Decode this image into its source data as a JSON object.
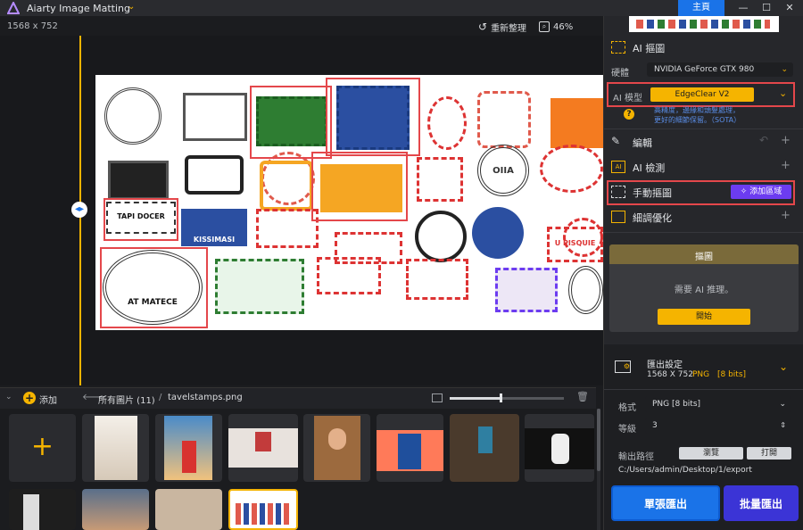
{
  "titlebar": {
    "app_title": "Aiarty Image Matting",
    "home_button": "主頁",
    "minimize": "—",
    "maximize": "☐",
    "close": "✕"
  },
  "toolbar": {
    "image_dims": "1568 x 752",
    "reset_label": "重新整理",
    "zoom_level": "46%"
  },
  "strip": {
    "add_label": "添加",
    "all_images_label": "所有圖片 (11)",
    "separator": "/",
    "current_file": "tavelstamps.png"
  },
  "panel": {
    "ai_matting_title": "AI 摳圖",
    "hardware_label": "硬體",
    "hardware_value": "NVIDIA GeForce GTX 980",
    "ai_model_label": "AI 模型",
    "ai_model_value": "EdgeClear  V2",
    "model_desc_line1": "高精度，邊緣和頭髮處理，",
    "model_desc_line2": "更好的細節保留。（SOTA）",
    "edit_label": "編輯",
    "ai_detect_label": "AI 檢測",
    "manual_matting_label": "手動摳圖",
    "add_area_button": "添加區域",
    "detail_optimize_label": "細調優化",
    "matting_card_title": "摳圖",
    "matting_card_desc": "需要 AI 推理。",
    "start_button": "開始",
    "export_settings_title": "匯出設定",
    "export_size": "1568 X 752",
    "export_format_tag": "PNG",
    "export_bits_tag": "[8 bits]",
    "format_label": "格式",
    "format_value": "PNG  [8 bits]",
    "level_label": "等級",
    "level_value": "3",
    "output_path_label": "輸出路徑",
    "browse_button": "瀏覽",
    "open_button": "打開",
    "output_path": "C:/Users/admin/Desktop/1/export",
    "single_export_button": "單張匯出",
    "batch_export_button": "批量匯出"
  },
  "stamps": {
    "bw_1": "TAPI DOCER",
    "blue_1": "KISSIMASI",
    "oval_1": "AT MATECE",
    "round_1": "OIIA",
    "red_1": "U PISQUIE"
  },
  "colors": {
    "accent": "#f5b400",
    "brand_blue": "#1a73e8",
    "selection_red": "#e4474b",
    "purple": "#6c3cf0"
  }
}
